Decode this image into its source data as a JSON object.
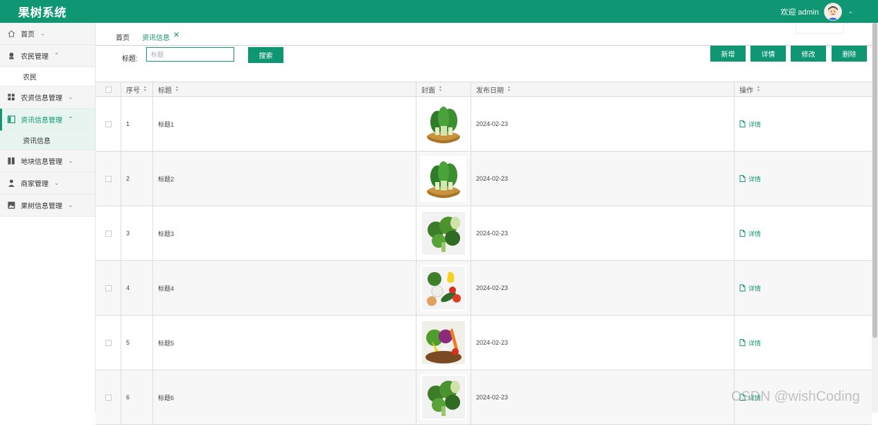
{
  "header": {
    "app_title": "果树系统",
    "welcome": "欢迎 admin"
  },
  "sidebar": {
    "items": [
      {
        "label": "首页",
        "icon": "home-icon"
      },
      {
        "label": "农民管理",
        "icon": "user-icon",
        "sub": [
          "农民"
        ]
      },
      {
        "label": "农资信息管理",
        "icon": "grid-icon"
      },
      {
        "label": "资讯信息管理",
        "icon": "panel-icon",
        "sub": [
          "资讯信息"
        ]
      },
      {
        "label": "地块信息管理",
        "icon": "columns-icon"
      },
      {
        "label": "商家管理",
        "icon": "person-icon"
      },
      {
        "label": "果树信息管理",
        "icon": "image-icon"
      }
    ]
  },
  "tabs": {
    "home": "首页",
    "active": "资讯信息"
  },
  "search": {
    "label": "标题:",
    "placeholder": "标题",
    "button": "搜索"
  },
  "actions": {
    "add": "新增",
    "detail": "详情",
    "edit": "修改",
    "delete": "删除"
  },
  "table": {
    "headers": [
      "序号",
      "标题",
      "封面",
      "发布日期",
      "操作"
    ],
    "row_action": "详情",
    "rows": [
      {
        "index": "1",
        "title": "标题1",
        "date": "2024-02-23",
        "cover": "bokchoy"
      },
      {
        "index": "2",
        "title": "标题2",
        "date": "2024-02-23",
        "cover": "bokchoy"
      },
      {
        "index": "3",
        "title": "标题3",
        "date": "2024-02-23",
        "cover": "broccoli"
      },
      {
        "index": "4",
        "title": "标题4",
        "date": "2024-02-23",
        "cover": "mixed"
      },
      {
        "index": "5",
        "title": "标题5",
        "date": "2024-02-23",
        "cover": "basket"
      },
      {
        "index": "6",
        "title": "标题6",
        "date": "2024-02-23",
        "cover": "broccoli"
      }
    ]
  },
  "watermark": "CSDN @wishCoding",
  "colors": {
    "primary": "#0f9673"
  }
}
